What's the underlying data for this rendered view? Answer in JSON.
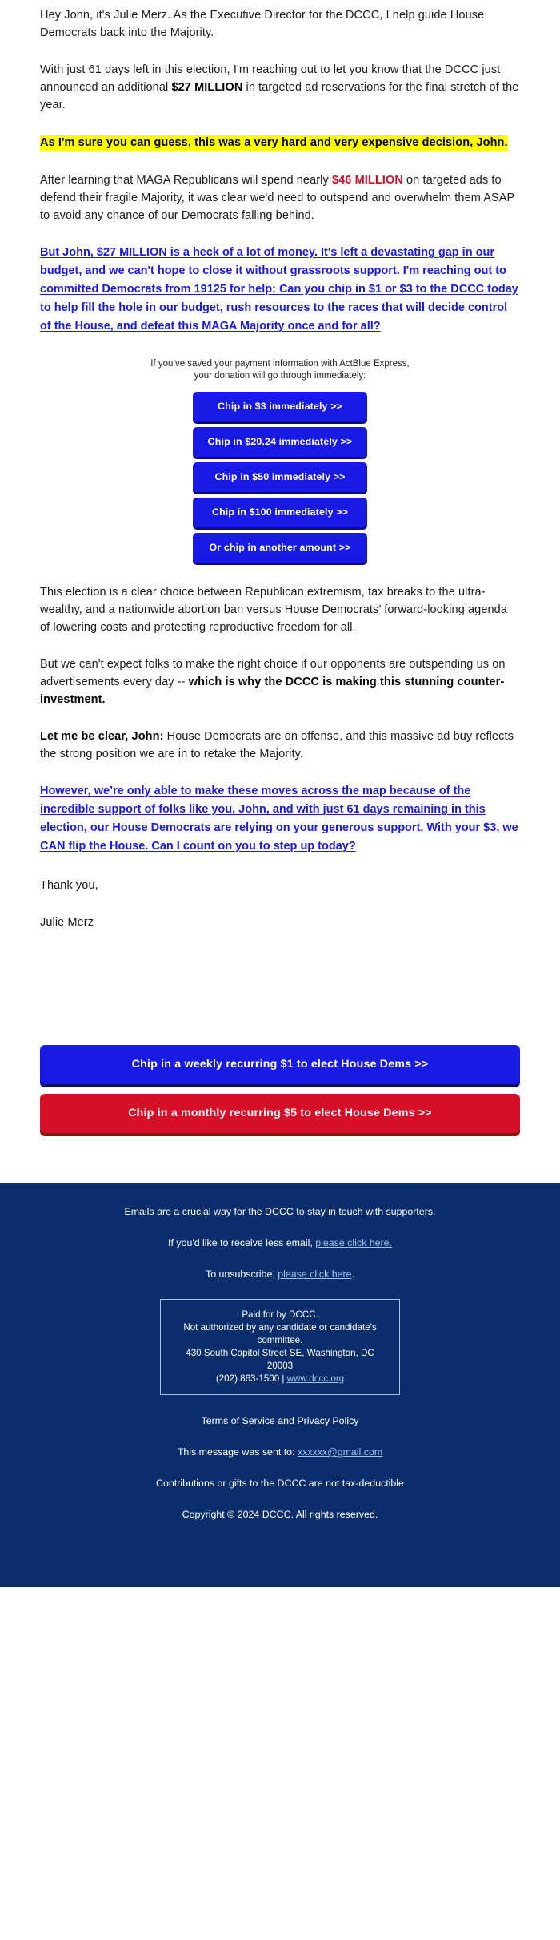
{
  "email": {
    "paragraphs": {
      "intro": {
        "text": "Hey John, it's Julie Merz. As the Executive Director for the DCCC, I help guide House Democrats back into the Majority."
      },
      "announcement_pre": "With just 61 days left in this election, I'm reaching out to let you know that the DCCC just announced an additional ",
      "announcement_amount": "$27 MILLION",
      "announcement_post": " in targeted ad reservations for the final stretch of the year.",
      "highlight": "As I'm sure you can guess, this was a very hard and very expensive decision, John.",
      "maga_pre": "After learning that MAGA Republicans will spend nearly ",
      "maga_amount": "$46 MILLION",
      "maga_post": " on targeted ads to defend their fragile Majority, it was clear we'd need to outspend and overwhelm them ASAP to avoid any chance of our Democrats falling behind.",
      "ask_link": "But John, $27 MILLION is a heck of a lot of money. It's left a devastating gap in our budget, and we can't hope to close it without grassroots support. I'm reaching out to committed Democrats from 19125 for help: Can you chip in $1 or $3 to the DCCC today to help fill the hole in our budget, rush resources to the races that will decide control of the House, and defeat this MAGA Majority once and for all?",
      "choice": "This election is a clear choice between Republican extremism, tax breaks to the ultra-wealthy, and a nationwide abortion ban versus House Democrats’ forward-looking agenda of lowering costs and protecting reproductive freedom for all.",
      "outspend_pre": "But we can't expect folks to make the right choice if our opponents are outspending us on advertisements every day -- ",
      "outspend_bold": "which is why the DCCC is making this stunning counter-investment.",
      "clear_bold": "Let me be clear, John:",
      "clear_rest": " House Democrats are on offense, and this massive ad buy reflects the strong position we are in to retake the Majority.",
      "closing_link": "However, we’re only able to make these moves across the map because of the incredible support of folks like you, John, and with just 61 days remaining in this election, our House Democrats are relying on your generous support. With your $3, we CAN flip the House. Can I count on you to step up today?",
      "signoff": "Thank you,",
      "signature": "Julie Merz"
    },
    "express": {
      "note_line1": "If you’ve saved your payment information with ActBlue Express,",
      "note_line2": "your donation will go through immediately:",
      "buttons": [
        {
          "label": "Chip in $3 immediately >>"
        },
        {
          "label": "Chip in $20.24 immediately >>"
        },
        {
          "label": "Chip in $50 immediately >>"
        },
        {
          "label": "Chip in $100 immediately >>"
        },
        {
          "label": "Or chip in another amount >>"
        }
      ]
    },
    "recurring": {
      "weekly_label": "Chip in a weekly recurring $1 to elect House Dems >>",
      "monthly_label": "Chip in a monthly recurring $5 to elect House Dems >>"
    },
    "footer": {
      "crucial": "Emails are a crucial way for the DCCC to stay in touch with supporters.",
      "less_email_pre": "If you'd like to receive less email, ",
      "less_email_link": "please click here.",
      "unsubscribe_pre": "To unsubscribe, ",
      "unsubscribe_link": "please click here",
      "unsubscribe_post": ".",
      "paid_line1": "Paid for by DCCC.",
      "paid_line2": "Not authorized by any candidate or candidate's committee.",
      "paid_line3": "430 South Capitol Street SE, Washington, DC 20003",
      "paid_phone": "(202) 863-1500 | ",
      "paid_site": "www.dccc.org",
      "terms": "Terms of Service and Privacy Policy",
      "sent_to_pre": "This message was sent to: ",
      "sent_to_email": "xxxxxx@gmail.com",
      "tax": "Contributions or gifts to the DCCC are not tax-deductible",
      "copyright": "Copyright © 2024 DCCC. All rights reserved."
    },
    "colors": {
      "link_blue": "#1a1ae0",
      "button_blue": "#1a1ae6",
      "button_red": "#d50f27",
      "highlight_yellow": "#ffff00",
      "accent_red": "#c8102e",
      "footer_navy": "#0a2e6b"
    }
  }
}
